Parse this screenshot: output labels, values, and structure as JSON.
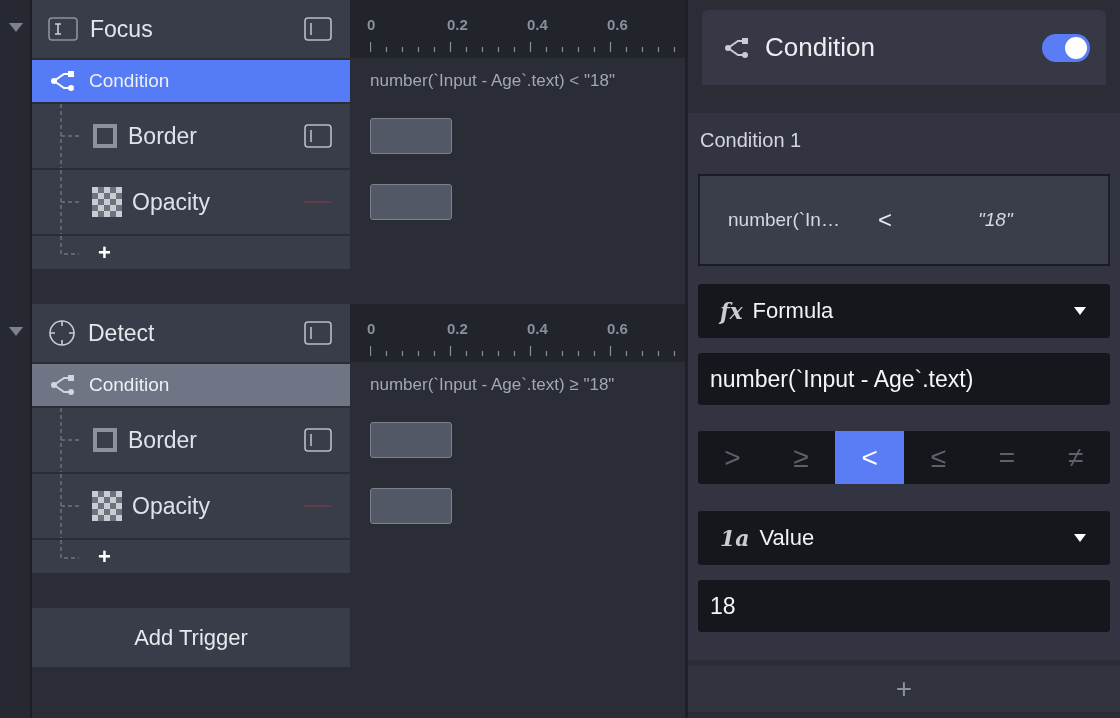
{
  "triggers": [
    {
      "name": "Focus",
      "kind": "focus",
      "expanded": true,
      "ruler": [
        "0",
        "0.2",
        "0.4",
        "0.6"
      ],
      "condition": {
        "label": "Condition",
        "selected": true,
        "expression": "number(`Input - Age`.text) < \"18\""
      },
      "properties": [
        {
          "name": "Border",
          "kind": "border"
        },
        {
          "name": "Opacity",
          "kind": "opacity"
        }
      ],
      "add_label": "+"
    },
    {
      "name": "Detect",
      "kind": "detect",
      "expanded": true,
      "ruler": [
        "0",
        "0.2",
        "0.4",
        "0.6"
      ],
      "condition": {
        "label": "Condition",
        "selected": false,
        "expression": "number(`Input - Age`.text) ≥ \"18\""
      },
      "properties": [
        {
          "name": "Border",
          "kind": "border"
        },
        {
          "name": "Opacity",
          "kind": "opacity"
        }
      ],
      "add_label": "+"
    }
  ],
  "add_trigger": "Add Trigger",
  "inspector": {
    "title": "Condition",
    "on": true,
    "section": "Condition 1",
    "summary": {
      "left": "number(`In…",
      "operator": "<",
      "right": "\"18\""
    },
    "left_source": {
      "badge": "fx",
      "label": "Formula"
    },
    "left_value": "number(`Input - Age`.text)",
    "operators": [
      {
        "symbol": ">",
        "selected": false
      },
      {
        "symbol": "≥",
        "selected": false
      },
      {
        "symbol": "<",
        "selected": true
      },
      {
        "symbol": "≤",
        "selected": false
      },
      {
        "symbol": "=",
        "selected": false
      },
      {
        "symbol": "≠",
        "selected": false
      }
    ],
    "right_source": {
      "badge": "1a",
      "label": "Value"
    },
    "right_value": "18",
    "add_label": "+"
  }
}
